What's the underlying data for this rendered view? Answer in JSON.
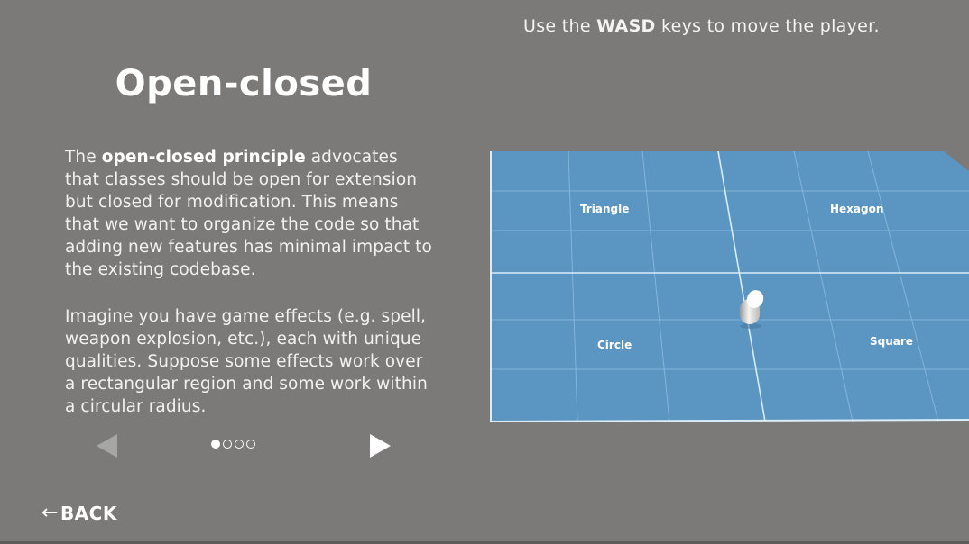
{
  "instruction": {
    "prefix": "Use the ",
    "keys": "WASD",
    "suffix": " keys to move the player."
  },
  "panel": {
    "title": "Open-closed",
    "para1": {
      "lead": "The ",
      "emphasis": "open-closed principle",
      "rest": " advocates that classes should be open for extension but closed for modification. This means that we want to organize the code so that adding new features has minimal impact to the existing codebase."
    },
    "para2": "Imagine you have game effects (e.g. spell, weapon explosion, etc.), each with unique qualities. Suppose some effects work over a rectangular region and some work within a circular radius."
  },
  "pagination": {
    "current": 1,
    "total": 4
  },
  "back": {
    "arrow": "←",
    "label": "BACK"
  },
  "scene": {
    "floor_color": "#5b95c2",
    "grid_color": "#8fc0e3",
    "zones": {
      "triangle": "Triangle",
      "hexagon": "Hexagon",
      "circle": "Circle",
      "square": "Square"
    }
  },
  "colors": {
    "background": "#7b7a78",
    "text": "#ffffff",
    "prev_disabled": "#a6a6a4"
  }
}
